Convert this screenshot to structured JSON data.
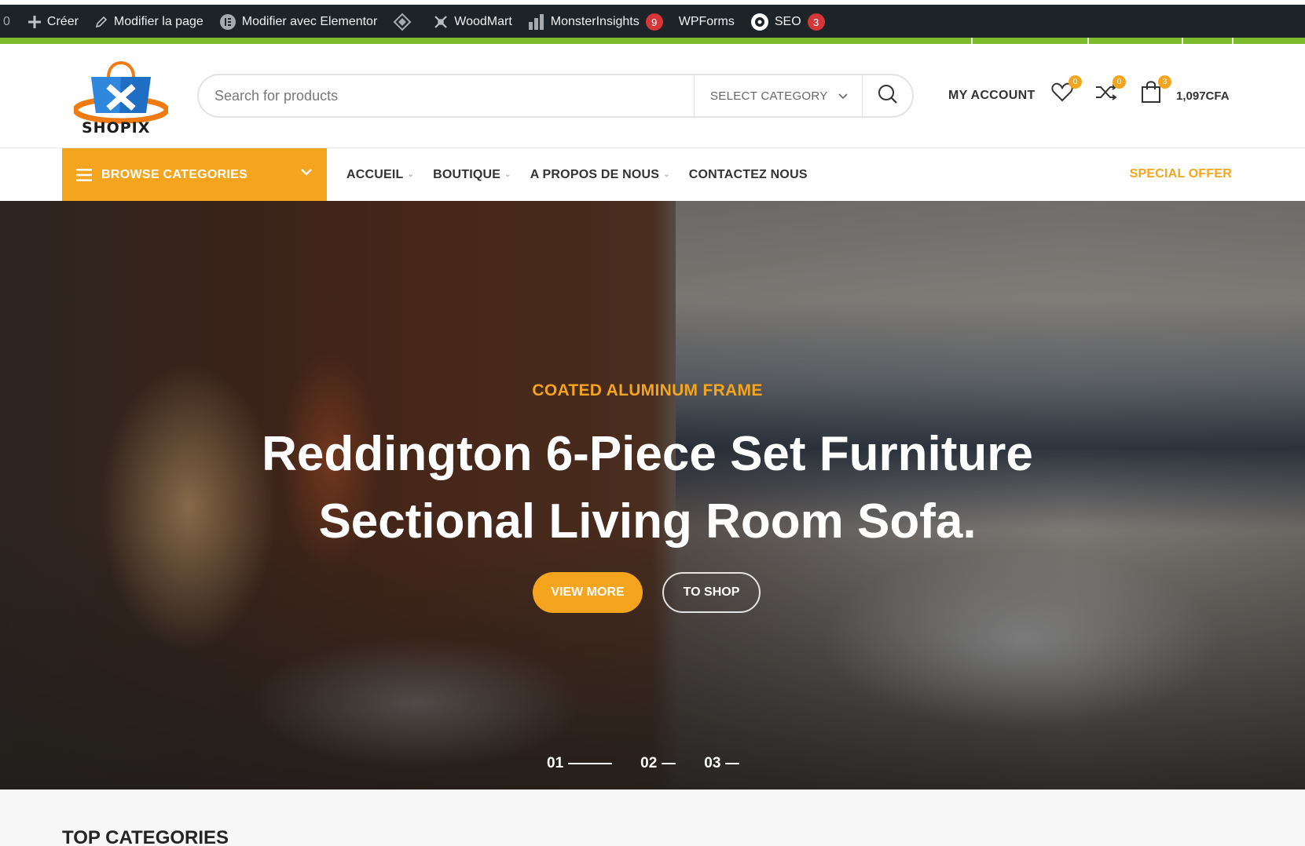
{
  "admin_bar": {
    "first": "0",
    "items": [
      {
        "label": "Créer",
        "icon": "plus-icon"
      },
      {
        "label": "Modifier la page",
        "icon": "pencil-icon"
      },
      {
        "label": "Modifier avec Elementor",
        "icon": "elementor-icon"
      },
      {
        "label": "",
        "icon": "diamond-icon"
      },
      {
        "label": "WoodMart",
        "icon": "woodmart-icon"
      },
      {
        "label": "MonsterInsights",
        "icon": "bar-chart-icon",
        "badge": "9"
      },
      {
        "label": "WPForms",
        "icon": ""
      },
      {
        "label": "SEO",
        "icon": "seo-gear-icon",
        "badge": "3"
      }
    ]
  },
  "header": {
    "logo_text": "SHOPIX",
    "search_placeholder": "Search for products",
    "category_select": "SELECT CATEGORY",
    "my_account": "MY ACCOUNT",
    "wishlist_count": "0",
    "compare_count": "0",
    "cart_count": "3",
    "cart_total": "1,097CFA"
  },
  "nav": {
    "browse_label": "BROWSE CATEGORIES",
    "items": [
      {
        "label": "ACCUEIL",
        "dropdown": true
      },
      {
        "label": "BOUTIQUE",
        "dropdown": true
      },
      {
        "label": "A PROPOS DE NOUS",
        "dropdown": true
      },
      {
        "label": "CONTACTEZ NOUS",
        "dropdown": false
      }
    ],
    "special_offer": "SPECIAL OFFER"
  },
  "hero": {
    "subtitle": "COATED ALUMINUM FRAME",
    "title_line1": "Reddington 6-Piece Set Furniture",
    "title_line2": "Sectional Living Room Sofa.",
    "button_primary": "VIEW MORE",
    "button_secondary": "TO SHOP",
    "slides": [
      "01",
      "02",
      "03"
    ],
    "active_slide": "01"
  },
  "section_title": "TOP CATEGORIES",
  "colors": {
    "accent": "#f5a51d",
    "admin_bar": "#1d2327",
    "green_strip": "#7cbb2c",
    "badge_red": "#d63638"
  }
}
